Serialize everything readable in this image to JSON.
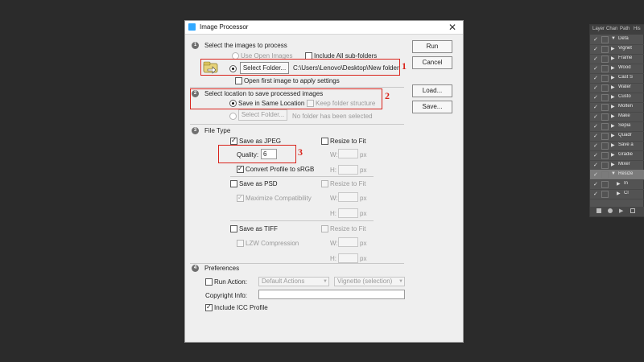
{
  "dialog": {
    "title": "Image Processor",
    "close_glyph": "✕",
    "buttons": {
      "run": "Run",
      "cancel": "Cancel",
      "load": "Load...",
      "save": "Save..."
    }
  },
  "section1": {
    "num": "1",
    "heading": "Select the images to process",
    "use_open_images": "Use Open Images",
    "include_subfolders": "Include All sub-folders",
    "select_folder": "Select Folder...",
    "folder_path": "C:\\Users\\Lenovo\\Desktop\\New folder",
    "open_first_image": "Open first image to apply settings"
  },
  "section2": {
    "num": "2",
    "heading": "Select location to save processed images",
    "save_same_location": "Save in Same Location",
    "keep_folder_structure": "Keep folder structure",
    "select_folder": "Select Folder...",
    "no_folder": "No folder has been selected"
  },
  "section3": {
    "num": "3",
    "heading": "File Type",
    "save_jpeg": "Save as JPEG",
    "resize_fit": "Resize to Fit",
    "quality_label": "Quality:",
    "quality_value": "6",
    "convert_srgb": "Convert Profile to sRGB",
    "save_psd": "Save as PSD",
    "maximize_compat": "Maximize Compatibility",
    "save_tiff": "Save as TIFF",
    "lzw": "LZW Compression",
    "w_label": "W:",
    "h_label": "H:",
    "px": "px"
  },
  "section4": {
    "num": "4",
    "heading": "Preferences",
    "run_action": "Run Action:",
    "action_set": "Default Actions",
    "action_name": "Vignette (selection)",
    "copyright": "Copyright Info:",
    "include_icc": "Include ICC Profile"
  },
  "annotations": {
    "a1": "1",
    "a2": "2",
    "a3": "3"
  },
  "panel": {
    "tabs": [
      "Layer",
      "Chan",
      "Path",
      "His"
    ],
    "rows": [
      "Defa",
      "Vignet",
      "Frame",
      "Wood",
      "Cast S",
      "Water",
      "Custo",
      "Molten",
      "Make",
      "Sepia",
      "Quadr",
      "Save a",
      "Gradie",
      "Mixer",
      "Resize",
      "In",
      "Cl"
    ]
  },
  "colors": {
    "accent_red": "#d9241c",
    "dialog_bg": "#efefef",
    "workspace_bg": "#2b2b2b"
  }
}
